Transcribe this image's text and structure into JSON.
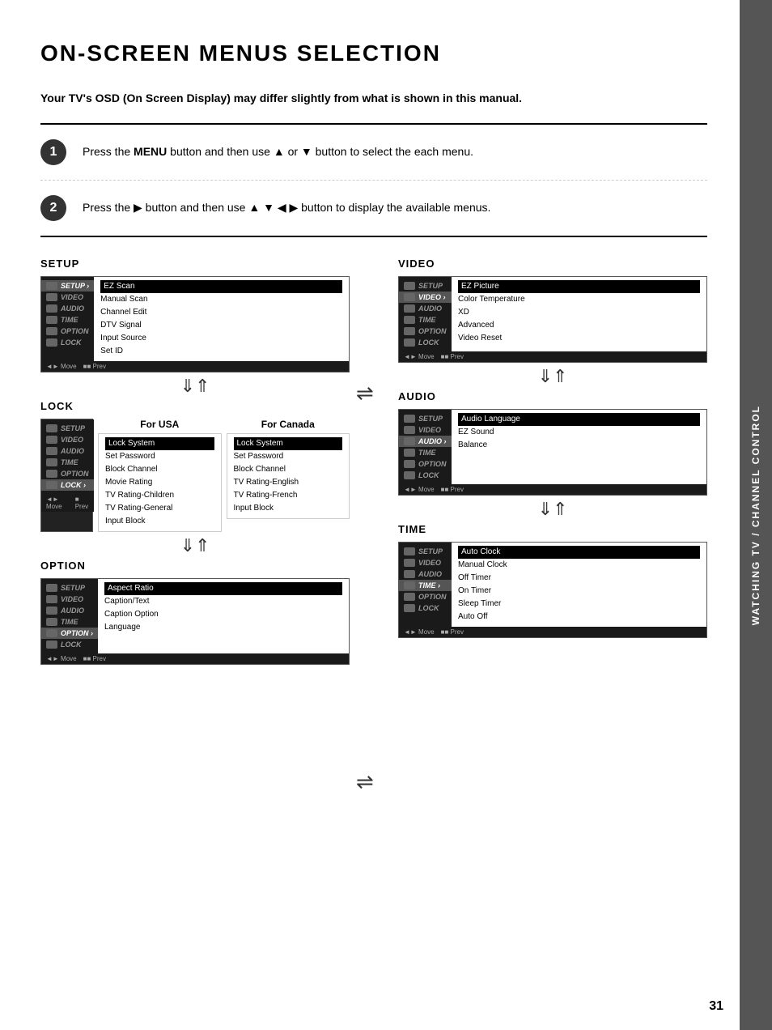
{
  "page": {
    "title": "ON-SCREEN MENUS SELECTION",
    "subtitle": "Your TV's OSD (On Screen Display) may differ slightly from what is shown in this manual.",
    "page_number": "31"
  },
  "steps": [
    {
      "number": "1",
      "text_before": "Press the ",
      "bold": "MENU",
      "text_after": " button and then use ▲ or ▼ button to select the each menu."
    },
    {
      "number": "2",
      "text_before": "Press the ▶ button and then use ▲ ▼ ◀ ▶ button to display the available menus."
    }
  ],
  "sidebar": {
    "text": "WATCHING TV / CHANNEL CONTROL"
  },
  "menus": {
    "setup": {
      "title": "SETUP",
      "left_items": [
        "SETUP",
        "VIDEO",
        "AUDIO",
        "TIME",
        "OPTION",
        "LOCK"
      ],
      "active_index": 0,
      "right_items": [
        "EZ Scan",
        "Manual Scan",
        "Channel Edit",
        "DTV Signal",
        "Input Source",
        "Set ID"
      ]
    },
    "video": {
      "title": "VIDEO",
      "left_items": [
        "SETUP",
        "VIDEO",
        "AUDIO",
        "TIME",
        "OPTION",
        "LOCK"
      ],
      "active_index": 1,
      "right_items": [
        "EZ Picture",
        "Color Temperature",
        "XD",
        "Advanced",
        "Video Reset"
      ]
    },
    "lock": {
      "title": "LOCK",
      "left_items": [
        "SETUP",
        "VIDEO",
        "AUDIO",
        "TIME",
        "OPTION",
        "LOCK"
      ],
      "active_index": 5,
      "usa_title": "For USA",
      "usa_items": [
        "Lock System",
        "Set Password",
        "Block Channel",
        "Movie Rating",
        "TV Rating-Children",
        "TV Rating-General",
        "Input Block"
      ],
      "canada_title": "For Canada",
      "canada_items": [
        "Lock System",
        "Set Password",
        "Block Channel",
        "TV Rating-English",
        "TV Rating-French",
        "Input Block"
      ]
    },
    "audio": {
      "title": "AUDIO",
      "left_items": [
        "SETUP",
        "VIDEO",
        "AUDIO",
        "TIME",
        "OPTION",
        "LOCK"
      ],
      "active_index": 2,
      "right_items": [
        "Audio Language",
        "EZ Sound",
        "Balance"
      ]
    },
    "option": {
      "title": "OPTION",
      "left_items": [
        "SETUP",
        "VIDEO",
        "AUDIO",
        "TIME",
        "OPTION",
        "LOCK"
      ],
      "active_index": 4,
      "right_items": [
        "Aspect Ratio",
        "Caption/Text",
        "Caption Option",
        "Language"
      ]
    },
    "time": {
      "title": "TIME",
      "left_items": [
        "SETUP",
        "VIDEO",
        "AUDIO",
        "TIME",
        "OPTION",
        "LOCK"
      ],
      "active_index": 3,
      "right_items": [
        "Auto Clock",
        "Manual Clock",
        "Off Timer",
        "On Timer",
        "Sleep Timer",
        "Auto Off"
      ]
    }
  }
}
